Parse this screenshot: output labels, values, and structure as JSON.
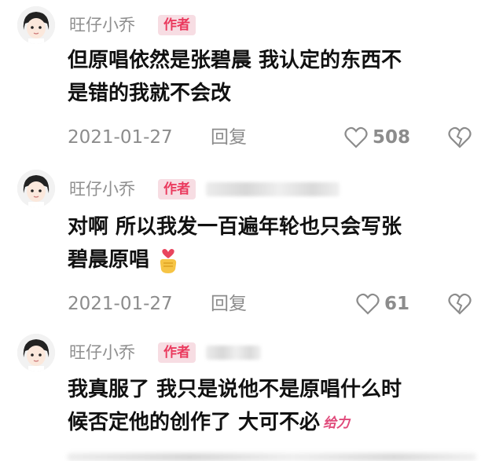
{
  "comments": [
    {
      "username": "旺仔小乔",
      "badge": "作者",
      "text_line1": "但原唱依然是张碧晨 我认定的东西不",
      "text_line2": "是错的我就不会改",
      "date": "2021-01-27",
      "reply_label": "回复",
      "likes": "508"
    },
    {
      "username": "旺仔小乔",
      "badge": "作者",
      "text_line1": "对啊 所以我发一百遍年轮也只会写张",
      "text_line2": "碧晨原唱",
      "date": "2021-01-27",
      "reply_label": "回复",
      "likes": "61"
    },
    {
      "username": "旺仔小乔",
      "badge": "作者",
      "text_line1": "我真服了 我只是说他不是原唱什么时",
      "text_line2": "候否定他的创作了 大可不必",
      "sticker": "给力"
    }
  ],
  "colors": {
    "badge_bg": "#f7dde3",
    "badge_text": "#ea3a5e",
    "muted": "#8c8c8c"
  }
}
